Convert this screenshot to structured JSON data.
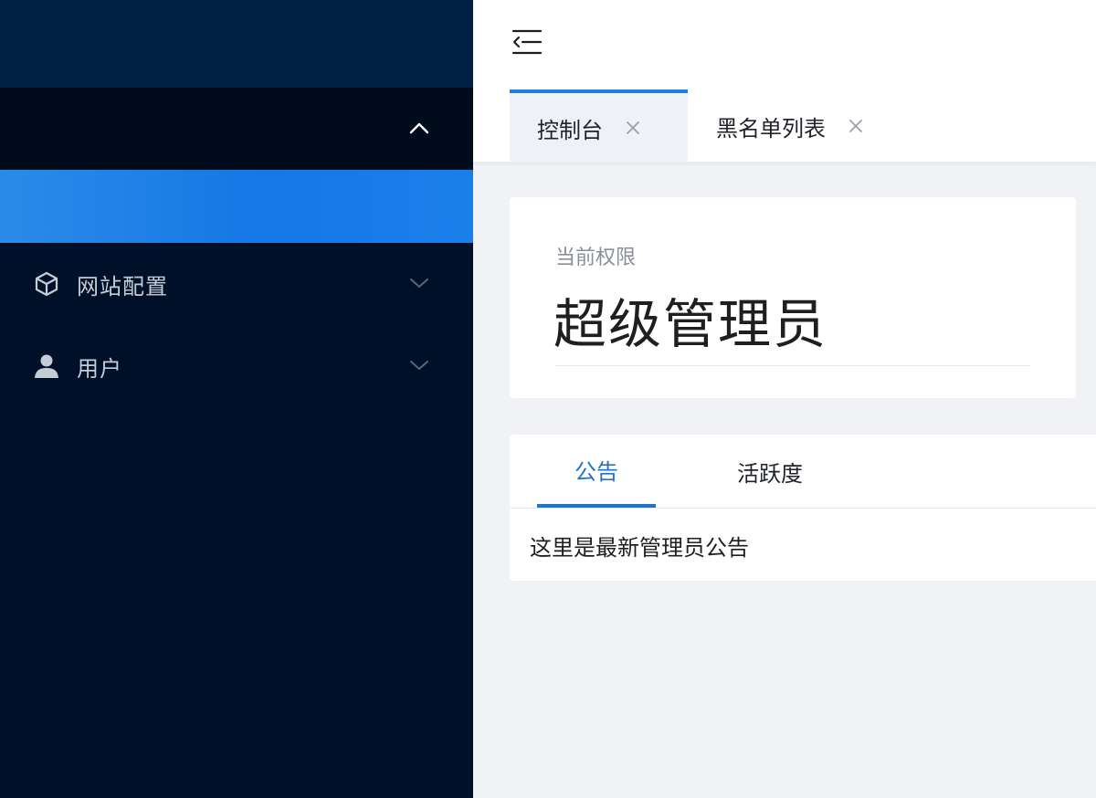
{
  "sidebar": {
    "menu": [
      {
        "label": "网站配置",
        "icon": "cube-icon"
      },
      {
        "label": "用户",
        "icon": "user-icon"
      }
    ]
  },
  "tabs": [
    {
      "label": "控制台",
      "active": true
    },
    {
      "label": "黑名单列表",
      "active": false
    }
  ],
  "permission": {
    "label": "当前权限",
    "value": "超级管理员"
  },
  "notice": {
    "tabs": [
      "公告",
      "活跃度"
    ],
    "content": "这里是最新管理员公告"
  },
  "colors": {
    "sidebar_bg": "#001029",
    "active_menu": "#1677e6",
    "accent": "#1f73c8"
  }
}
